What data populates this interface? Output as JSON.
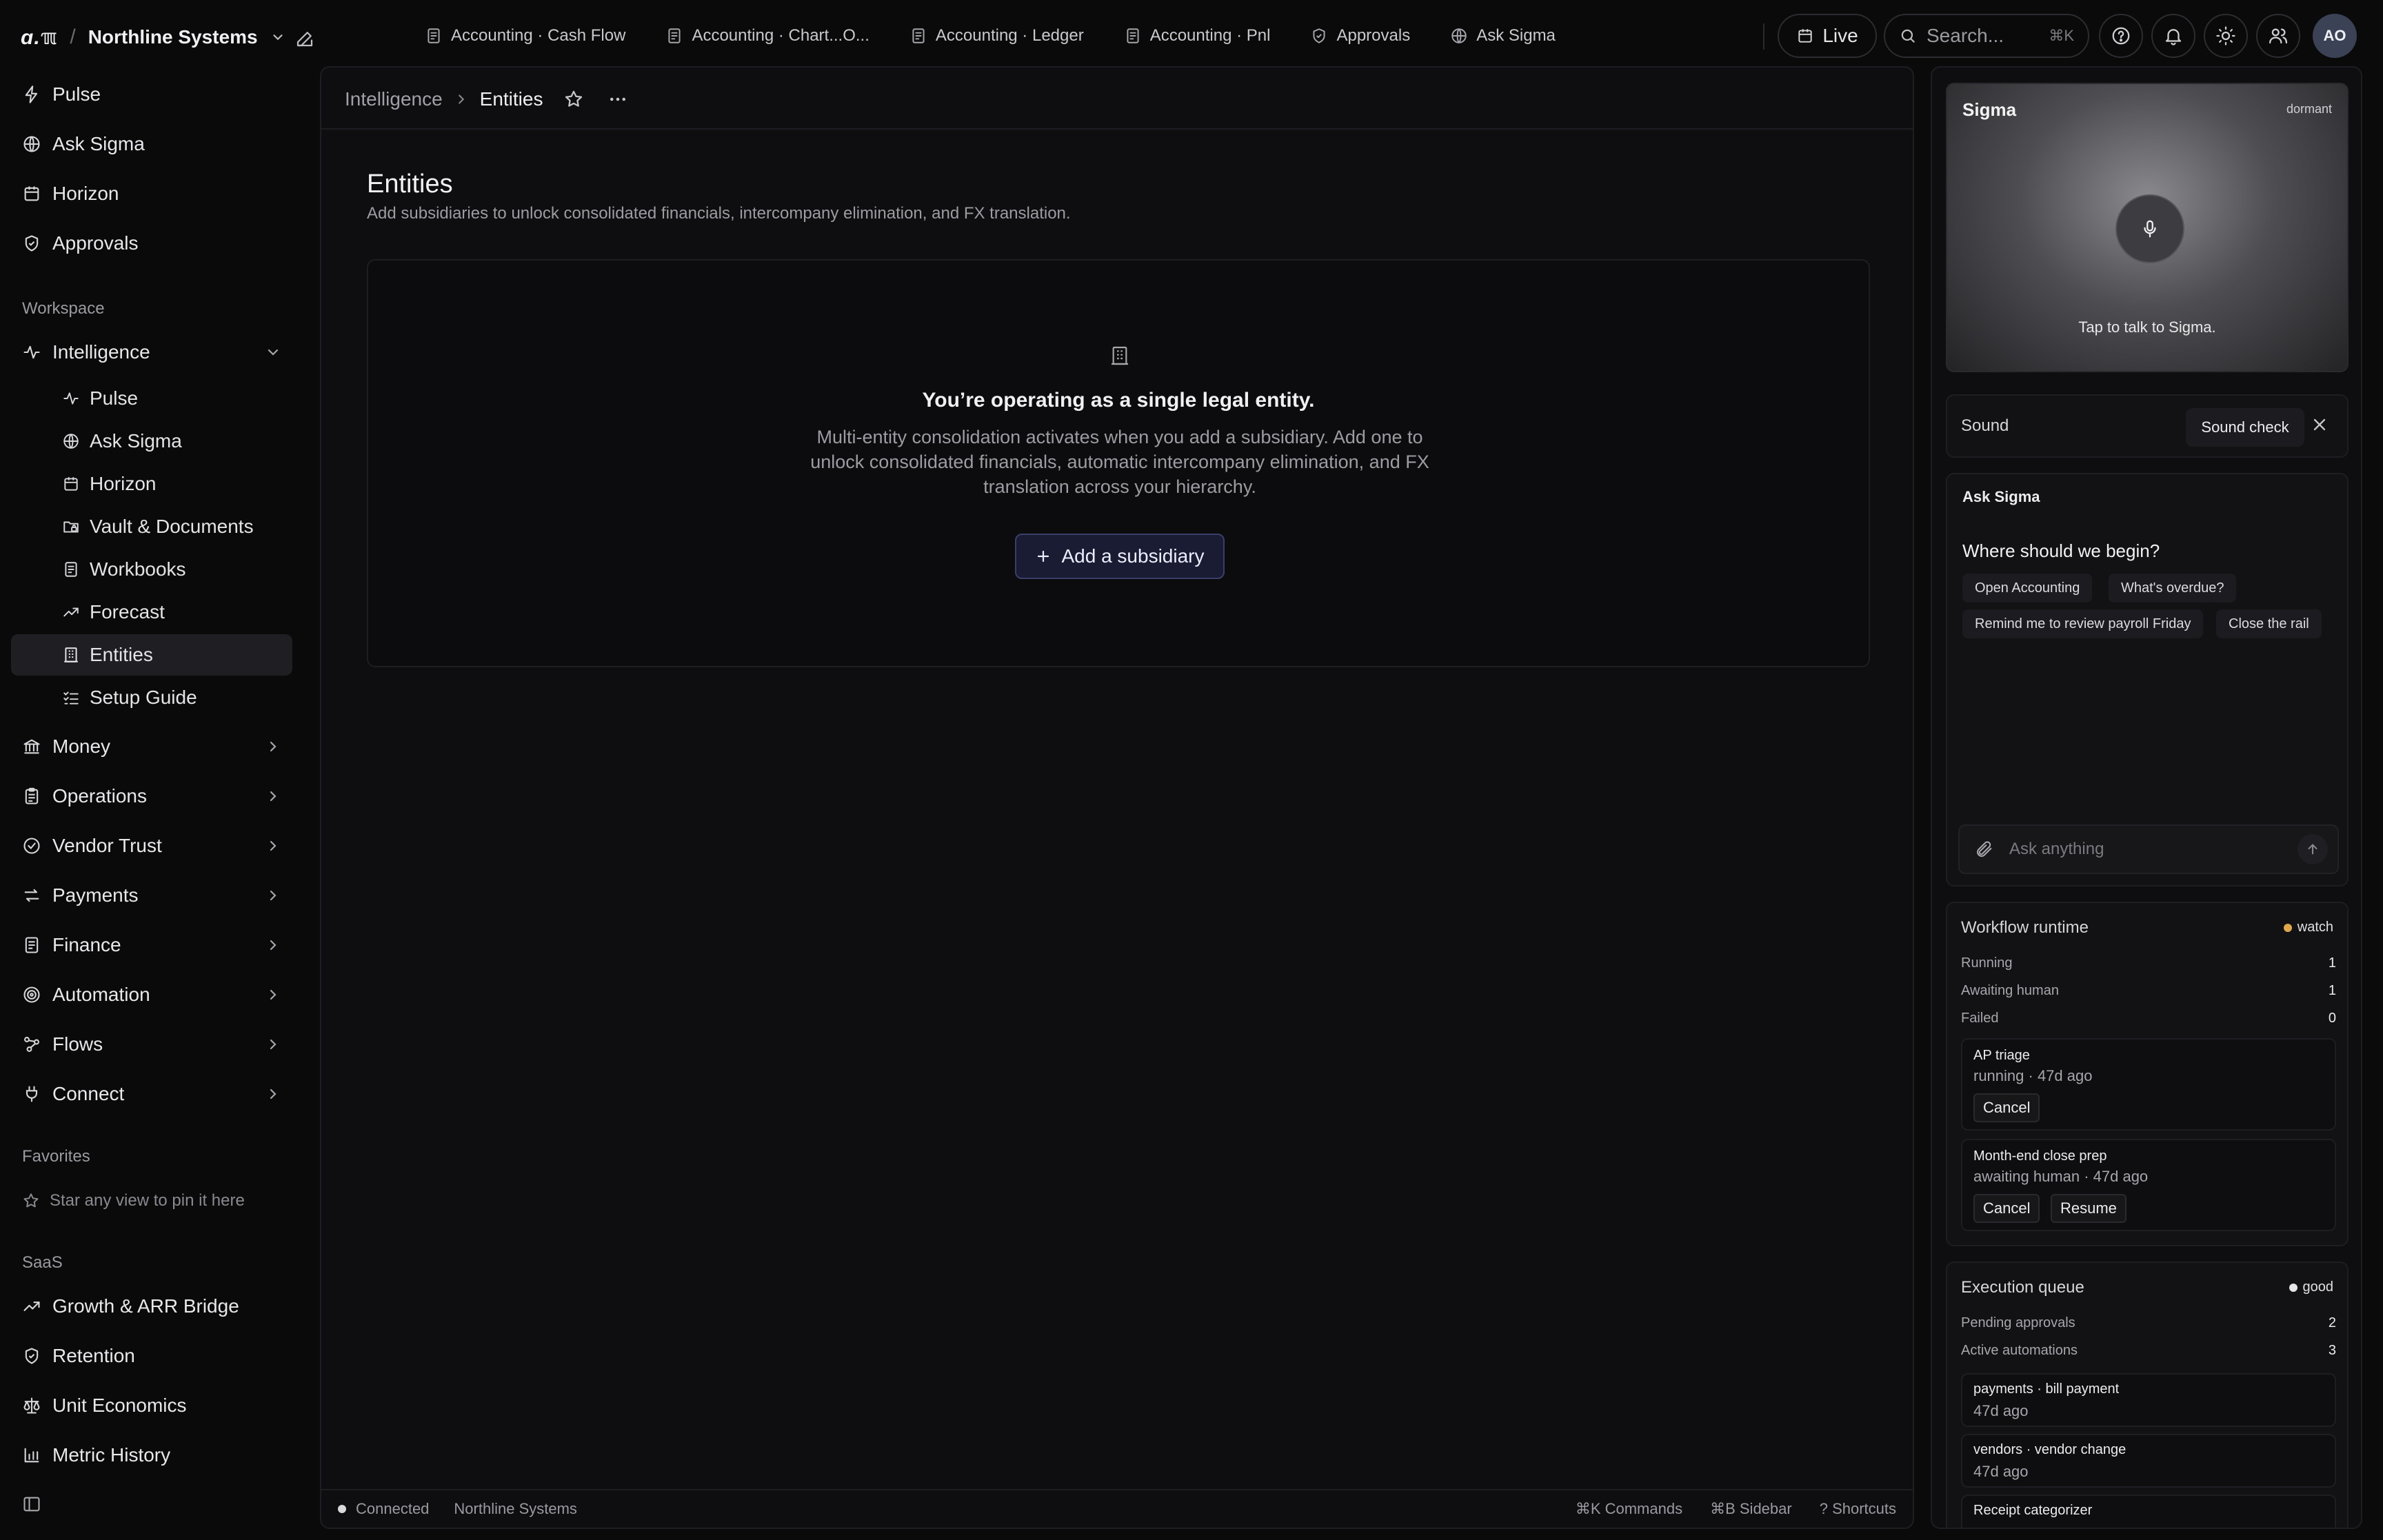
{
  "topbar": {
    "logo": "ɑ.ℼ",
    "org": "Northline Systems",
    "tabs": [
      {
        "label": "Accounting · Cash Flow"
      },
      {
        "label": "Accounting · Chart...O..."
      },
      {
        "label": "Accounting · Ledger"
      },
      {
        "label": "Accounting · Pnl"
      },
      {
        "label": "Approvals"
      },
      {
        "label": "Ask Sigma"
      }
    ],
    "live_label": "Live",
    "search_placeholder": "Search...",
    "search_kbd": "⌘K",
    "avatar": "AO"
  },
  "sidebar": {
    "top_items": [
      {
        "label": "Pulse",
        "icon": "bolt-icon"
      },
      {
        "label": "Ask Sigma",
        "icon": "globe-icon"
      },
      {
        "label": "Horizon",
        "icon": "calendar-icon"
      },
      {
        "label": "Approvals",
        "icon": "shield-check-icon"
      }
    ],
    "workspace_label": "Workspace",
    "intelligence": {
      "label": "Intelligence",
      "children": [
        {
          "label": "Pulse"
        },
        {
          "label": "Ask Sigma"
        },
        {
          "label": "Horizon"
        },
        {
          "label": "Vault & Documents"
        },
        {
          "label": "Workbooks"
        },
        {
          "label": "Forecast"
        },
        {
          "label": "Entities"
        },
        {
          "label": "Setup Guide"
        }
      ]
    },
    "groups": [
      {
        "label": "Money"
      },
      {
        "label": "Operations"
      },
      {
        "label": "Vendor Trust"
      },
      {
        "label": "Payments"
      },
      {
        "label": "Finance"
      },
      {
        "label": "Automation"
      },
      {
        "label": "Flows"
      },
      {
        "label": "Connect"
      }
    ],
    "favorites_label": "Favorites",
    "favorites_hint": "Star any view to pin it here",
    "saas_label": "SaaS",
    "saas_items": [
      {
        "label": "Growth & ARR Bridge"
      },
      {
        "label": "Retention"
      },
      {
        "label": "Unit Economics"
      },
      {
        "label": "Metric History"
      }
    ]
  },
  "main": {
    "breadcrumb": {
      "parent": "Intelligence",
      "current": "Entities"
    },
    "title": "Entities",
    "subtitle": "Add subsidiaries to unlock consolidated financials, intercompany elimination, and FX translation.",
    "empty": {
      "title": "You’re operating as a single legal entity.",
      "description": "Multi-entity consolidation activates when you add a subsidiary. Add one to unlock consolidated financials, automatic intercompany elimination, and FX translation across your hierarchy.",
      "button": "Add a subsidiary"
    },
    "status": {
      "connection": "Connected",
      "org": "Northline Systems",
      "commands": "⌘K Commands",
      "sidebar": "⌘B Sidebar",
      "shortcuts": "? Shortcuts"
    }
  },
  "rail": {
    "sigma": {
      "title": "Sigma",
      "state": "dormant",
      "hint": "Tap to talk to Sigma."
    },
    "sound": {
      "label": "Sound",
      "check": "Sound check"
    },
    "ask": {
      "title": "Ask Sigma",
      "question": "Where should we begin?",
      "chips": [
        "Open Accounting",
        "What's overdue?",
        "Remind me to review payroll Friday",
        "Close the rail"
      ],
      "placeholder": "Ask anything"
    },
    "workflow": {
      "title": "Workflow runtime",
      "badge": "watch",
      "badge_color": "#e0a84a",
      "metrics": [
        {
          "label": "Running",
          "value": "1"
        },
        {
          "label": "Awaiting human",
          "value": "1"
        },
        {
          "label": "Failed",
          "value": "0"
        }
      ],
      "runs": [
        {
          "name": "AP triage",
          "status": "running · 47d ago",
          "actions": [
            "Cancel"
          ]
        },
        {
          "name": "Month-end close prep",
          "status": "awaiting human · 47d ago",
          "actions": [
            "Cancel",
            "Resume"
          ]
        }
      ]
    },
    "execution": {
      "title": "Execution queue",
      "badge": "good",
      "badge_color": "#e6e6e8",
      "metrics": [
        {
          "label": "Pending approvals",
          "value": "2"
        },
        {
          "label": "Active automations",
          "value": "3"
        }
      ],
      "items": [
        {
          "name": "payments · bill payment",
          "time": "47d ago"
        },
        {
          "name": "vendors · vendor change",
          "time": "47d ago"
        },
        {
          "name": "Receipt categorizer",
          "time": ""
        }
      ]
    }
  }
}
